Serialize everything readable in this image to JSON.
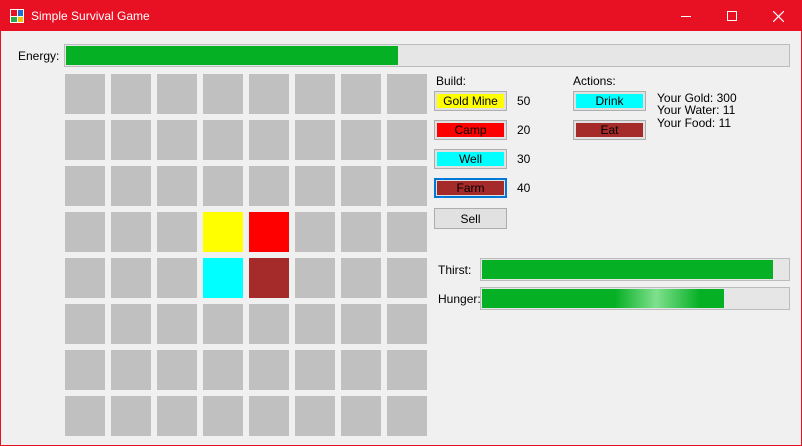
{
  "window": {
    "title": "Simple Survival Game"
  },
  "colors": {
    "titlebar": "#e81123",
    "progress": "#06b025",
    "cell": "#c0c0c0",
    "gold_mine": "#ffff00",
    "camp": "#ff0000",
    "well": "#00ffff",
    "farm": "#a52a2a"
  },
  "energy": {
    "label": "Energy:",
    "value": 0.46
  },
  "grid": {
    "rows": 8,
    "cols": 8,
    "placed": [
      {
        "row": 3,
        "col": 3,
        "type": "gold_mine"
      },
      {
        "row": 3,
        "col": 4,
        "type": "camp"
      },
      {
        "row": 4,
        "col": 3,
        "type": "well"
      },
      {
        "row": 4,
        "col": 4,
        "type": "farm"
      }
    ]
  },
  "build": {
    "label": "Build:",
    "items": [
      {
        "label": "Gold Mine",
        "cost": "50",
        "color": "#ffff00"
      },
      {
        "label": "Camp",
        "cost": "20",
        "color": "#ff0000"
      },
      {
        "label": "Well",
        "cost": "30",
        "color": "#00ffff"
      },
      {
        "label": "Farm",
        "cost": "40",
        "color": "#a52a2a"
      }
    ],
    "sell_label": "Sell"
  },
  "actions": {
    "label": "Actions:",
    "drink_label": "Drink",
    "drink_color": "#00ffff",
    "eat_label": "Eat",
    "eat_color": "#a52a2a"
  },
  "stats": {
    "gold": "Your Gold: 300",
    "water": "Your Water: 11",
    "food": "Your Food: 11"
  },
  "thirst": {
    "label": "Thirst:",
    "value": 0.95
  },
  "hunger": {
    "label": "Hunger:",
    "value": 0.79
  }
}
